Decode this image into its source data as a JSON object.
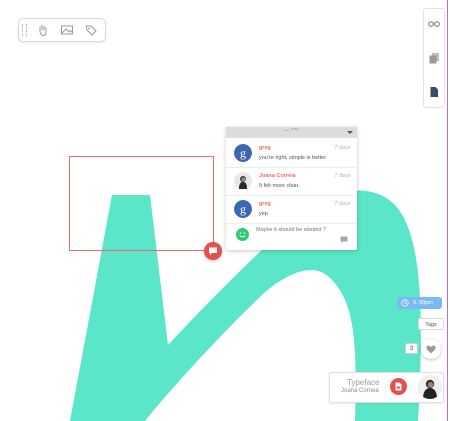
{
  "toolbar": {
    "tools": [
      "hand-icon",
      "image-icon",
      "tag-icon"
    ]
  },
  "right_rail": {
    "buttons": [
      "glasses-icon",
      "pages-icon",
      "document-icon"
    ]
  },
  "comment_thread": {
    "header_hint": "— ***",
    "messages": [
      {
        "author": "greg",
        "time": "7 days",
        "text": "you're right, simple is better",
        "avatar": "google-avatar"
      },
      {
        "author": "Joana Correia",
        "time": "7 days",
        "text": "It felt more clear.",
        "avatar": "user-photo-avatar"
      },
      {
        "author": "greg",
        "time": "7 days",
        "text": "yep",
        "avatar": "google-avatar"
      }
    ],
    "reply_placeholder": "Maybe it should be slanted ?"
  },
  "status_badge": {
    "label": "0. 00pm"
  },
  "tags_button": {
    "label": "Tags"
  },
  "likes": {
    "count": "3"
  },
  "document_card": {
    "name": "Typeface",
    "owner": "Joana Correia"
  },
  "colors": {
    "accent_red": "#e5504c",
    "selection_border": "#f26a6a",
    "shape_teal": "#5ce6c9",
    "badge_blue": "#7ab9f5",
    "google_blue": "#3b66b0",
    "smile_green": "#2ecc71"
  }
}
